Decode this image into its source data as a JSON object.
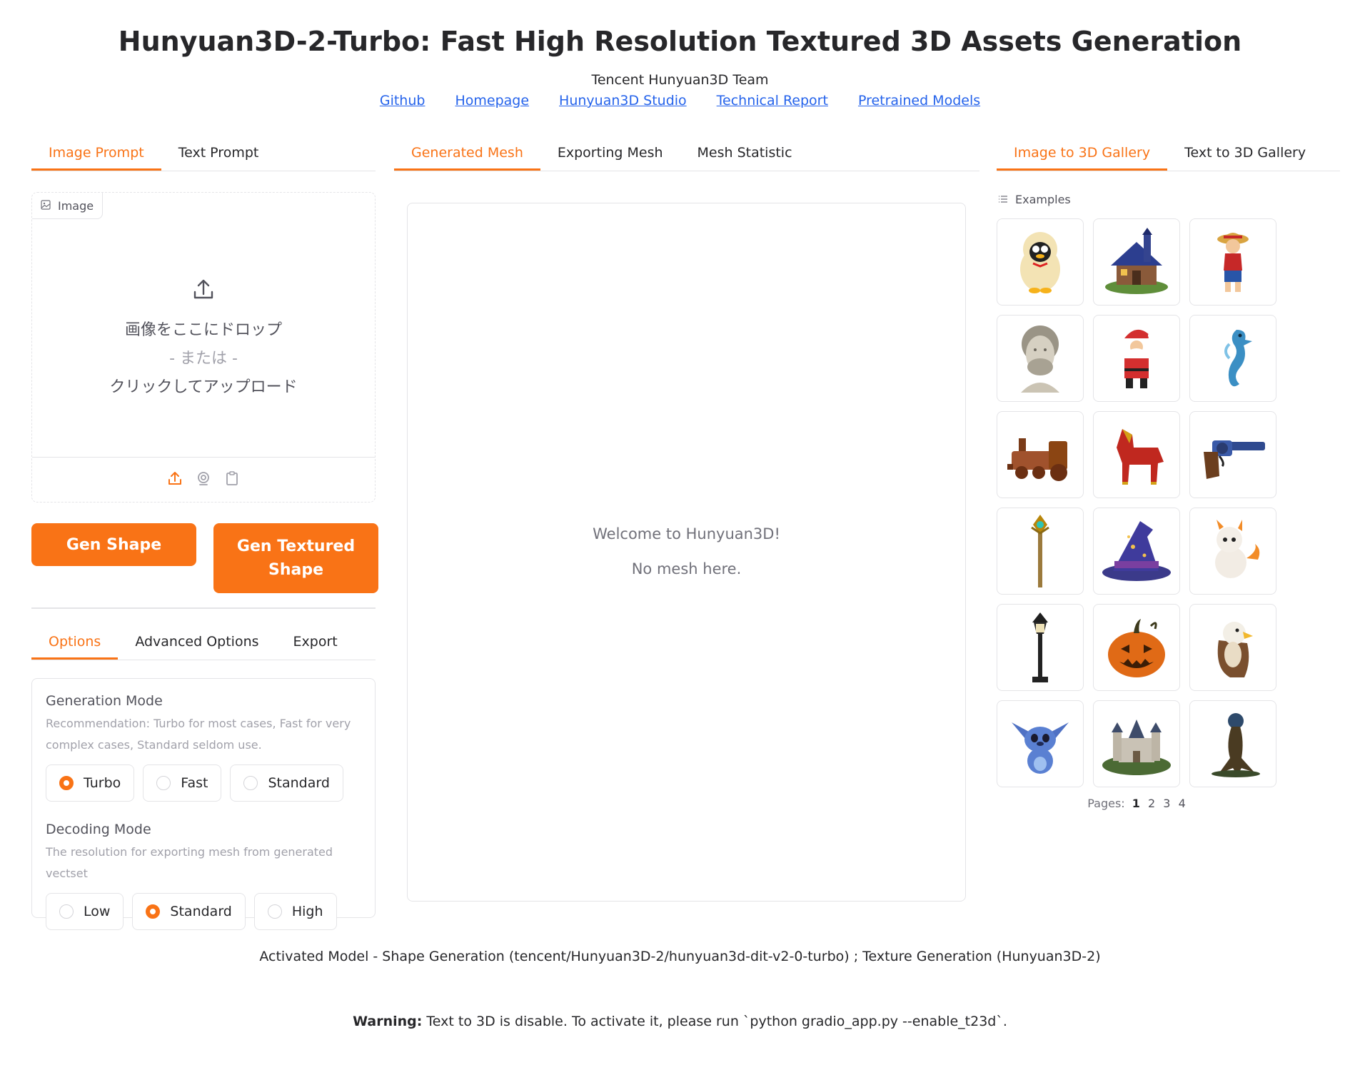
{
  "header": {
    "title": "Hunyuan3D-2-Turbo: Fast High Resolution Textured 3D Assets Generation",
    "team": "Tencent Hunyuan3D Team",
    "links": [
      "Github",
      "Homepage",
      "Hunyuan3D Studio",
      "Technical Report",
      "Pretrained Models"
    ]
  },
  "left": {
    "tabs": [
      "Image Prompt",
      "Text Prompt"
    ],
    "image_label": "Image",
    "drop_line1": "画像をここにドロップ",
    "drop_or": "- または -",
    "drop_line2": "クリックしてアップロード",
    "gen_shape": "Gen Shape",
    "gen_textured_line1": "Gen Textured",
    "gen_textured_line2": "Shape",
    "option_tabs": [
      "Options",
      "Advanced Options",
      "Export"
    ],
    "generation_mode": {
      "label": "Generation Mode",
      "info_line1": "Recommendation: Turbo for most cases, Fast for very",
      "info_line2": "complex cases, Standard seldom use.",
      "options": [
        "Turbo",
        "Fast",
        "Standard"
      ],
      "selected": "Turbo"
    },
    "decoding_mode": {
      "label": "Decoding Mode",
      "info": "The resolution for exporting mesh from generated vectset",
      "options": [
        "Low",
        "Standard",
        "High"
      ],
      "selected": "Standard"
    }
  },
  "center": {
    "tabs": [
      "Generated Mesh",
      "Exporting Mesh",
      "Mesh Statistic"
    ],
    "welcome": "Welcome to Hunyuan3D!",
    "no_mesh": "No mesh here."
  },
  "right": {
    "tabs": [
      "Image to 3D Gallery",
      "Text to 3D Gallery"
    ],
    "examples_label": "Examples",
    "examples": [
      "penguin-mascot",
      "blue-house",
      "pirate-boy",
      "marble-bust",
      "santa-claus",
      "seahorse",
      "toy-train",
      "red-horse",
      "revolver",
      "magic-staff",
      "wizard-hat",
      "baby-dragon",
      "street-lamp",
      "jack-o-lantern",
      "eagle",
      "stitch",
      "castle",
      "tree-orb"
    ],
    "pages_label": "Pages:",
    "pages": [
      "1",
      "2",
      "3",
      "4"
    ]
  },
  "footer": {
    "activated": "Activated Model - Shape Generation (tencent/Hunyuan3D-2/hunyuan3d-dit-v2-0-turbo) ; Texture Generation (Hunyuan3D-2)",
    "warning_bold": "Warning:",
    "warning_text": " Text to 3D is disable. To activate it, please run `python gradio_app.py --enable_t23d`."
  },
  "colors": {
    "accent": "#f97316",
    "link": "#2563eb",
    "border": "#e4e4e7"
  }
}
